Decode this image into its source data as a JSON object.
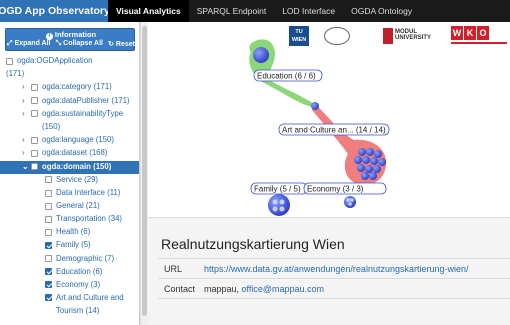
{
  "navbar": {
    "brand": "OGD App Observatory",
    "tabs": [
      {
        "label": "Visual Analytics",
        "active": true
      },
      {
        "label": "SPARQL Endpoint",
        "active": false
      },
      {
        "label": "LOD Interface",
        "active": false
      },
      {
        "label": "OGDA Ontology",
        "active": false
      }
    ]
  },
  "sidebar": {
    "info_title": "Information",
    "expand_label": "Expand All",
    "collapse_label": "Collapse All",
    "reset_label": "Reset",
    "tree": [
      {
        "label": "ogda:OGDApplication",
        "line2": "(171)",
        "level": 0,
        "chevron": "",
        "checked": false,
        "selected": false
      },
      {
        "label": "ogda:category (171)",
        "level": 1,
        "chevron": "›",
        "checked": false,
        "selected": false
      },
      {
        "label": "ogda:dataPublisher (171)",
        "level": 1,
        "chevron": "›",
        "checked": false,
        "selected": false
      },
      {
        "label": "ogda:sustainabilityType",
        "line2": "(150)",
        "level": 1,
        "chevron": "›",
        "checked": false,
        "selected": false
      },
      {
        "label": "ogda:language (150)",
        "level": 1,
        "chevron": "›",
        "checked": false,
        "selected": false
      },
      {
        "label": "ogda:dataset (168)",
        "level": 1,
        "chevron": "›",
        "checked": false,
        "selected": false
      },
      {
        "label": "ogda:domain (150)",
        "level": 1,
        "chevron": "⌄",
        "checked": false,
        "selected": true
      },
      {
        "label": "Service (29)",
        "level": 2,
        "checked": false
      },
      {
        "label": "Data Interface (11)",
        "level": 2,
        "checked": false
      },
      {
        "label": "General (21)",
        "level": 2,
        "checked": false
      },
      {
        "label": "Transportation (34)",
        "level": 2,
        "checked": false
      },
      {
        "label": "Health (6)",
        "level": 2,
        "checked": false
      },
      {
        "label": "Family (5)",
        "level": 2,
        "checked": true
      },
      {
        "label": "Demographic (7)",
        "level": 2,
        "checked": false
      },
      {
        "label": "Education (6)",
        "level": 2,
        "checked": true
      },
      {
        "label": "Economy (3)",
        "level": 2,
        "checked": true
      },
      {
        "label": "Art and Culture and",
        "line2": "Tourism (14)",
        "level": 2,
        "checked": true
      }
    ]
  },
  "viz": {
    "logos": [
      "TU WIEN",
      "MODUL UNIVERSITY",
      "WKO"
    ],
    "nodes": [
      {
        "label": "Education (6 / 6)"
      },
      {
        "label": "Art and Culture an... (14 / 14)"
      },
      {
        "label": "Family (5 / 5)"
      },
      {
        "label": "Economy (3 / 3)"
      }
    ],
    "colors": {
      "education_blob": "#7fd36a",
      "art_blob": "#f07070",
      "node": "#3a4fd0"
    }
  },
  "detail": {
    "title": "Realnutzungskartierung Wien",
    "rows": [
      {
        "key": "URL",
        "value": "https://www.data.gv.at/anwendungen/realnutzungskartierung-wien/"
      },
      {
        "key": "Contact",
        "value": "mappau, ",
        "link": "office@mappau.com"
      }
    ]
  }
}
